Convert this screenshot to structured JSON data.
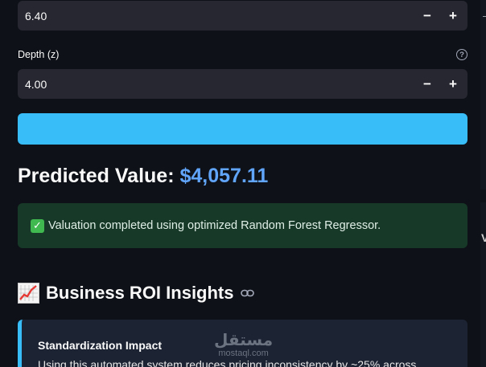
{
  "inputs": {
    "width_value": "6.40",
    "depth_label": "Depth (z)",
    "depth_value": "4.00",
    "help_glyph": "?",
    "minus_glyph": "−",
    "plus_glyph": "+"
  },
  "prediction": {
    "label": "Predicted Value:",
    "amount": "$4,057.11"
  },
  "success": {
    "check_glyph": "✓",
    "message": "Valuation completed using optimized Random Forest Regressor."
  },
  "section": {
    "title": "Business ROI Insights"
  },
  "card": {
    "title": "Standardization Impact",
    "body": "Using this automated system reduces pricing inconsistency by ~25% across"
  },
  "watermark": {
    "arabic": "مستقل",
    "latin": "mostaql.com"
  },
  "right_edge_letter": "V",
  "colors": {
    "background": "#0e1117",
    "input_bg": "#262730",
    "button": "#38bdf8",
    "amount": "#60a5fa",
    "success_bg": "#173928",
    "card_bg": "#1c2333"
  },
  "icons": [
    "minus-icon",
    "plus-icon",
    "help-icon",
    "check-icon",
    "chart-increasing-icon",
    "link-icon"
  ]
}
